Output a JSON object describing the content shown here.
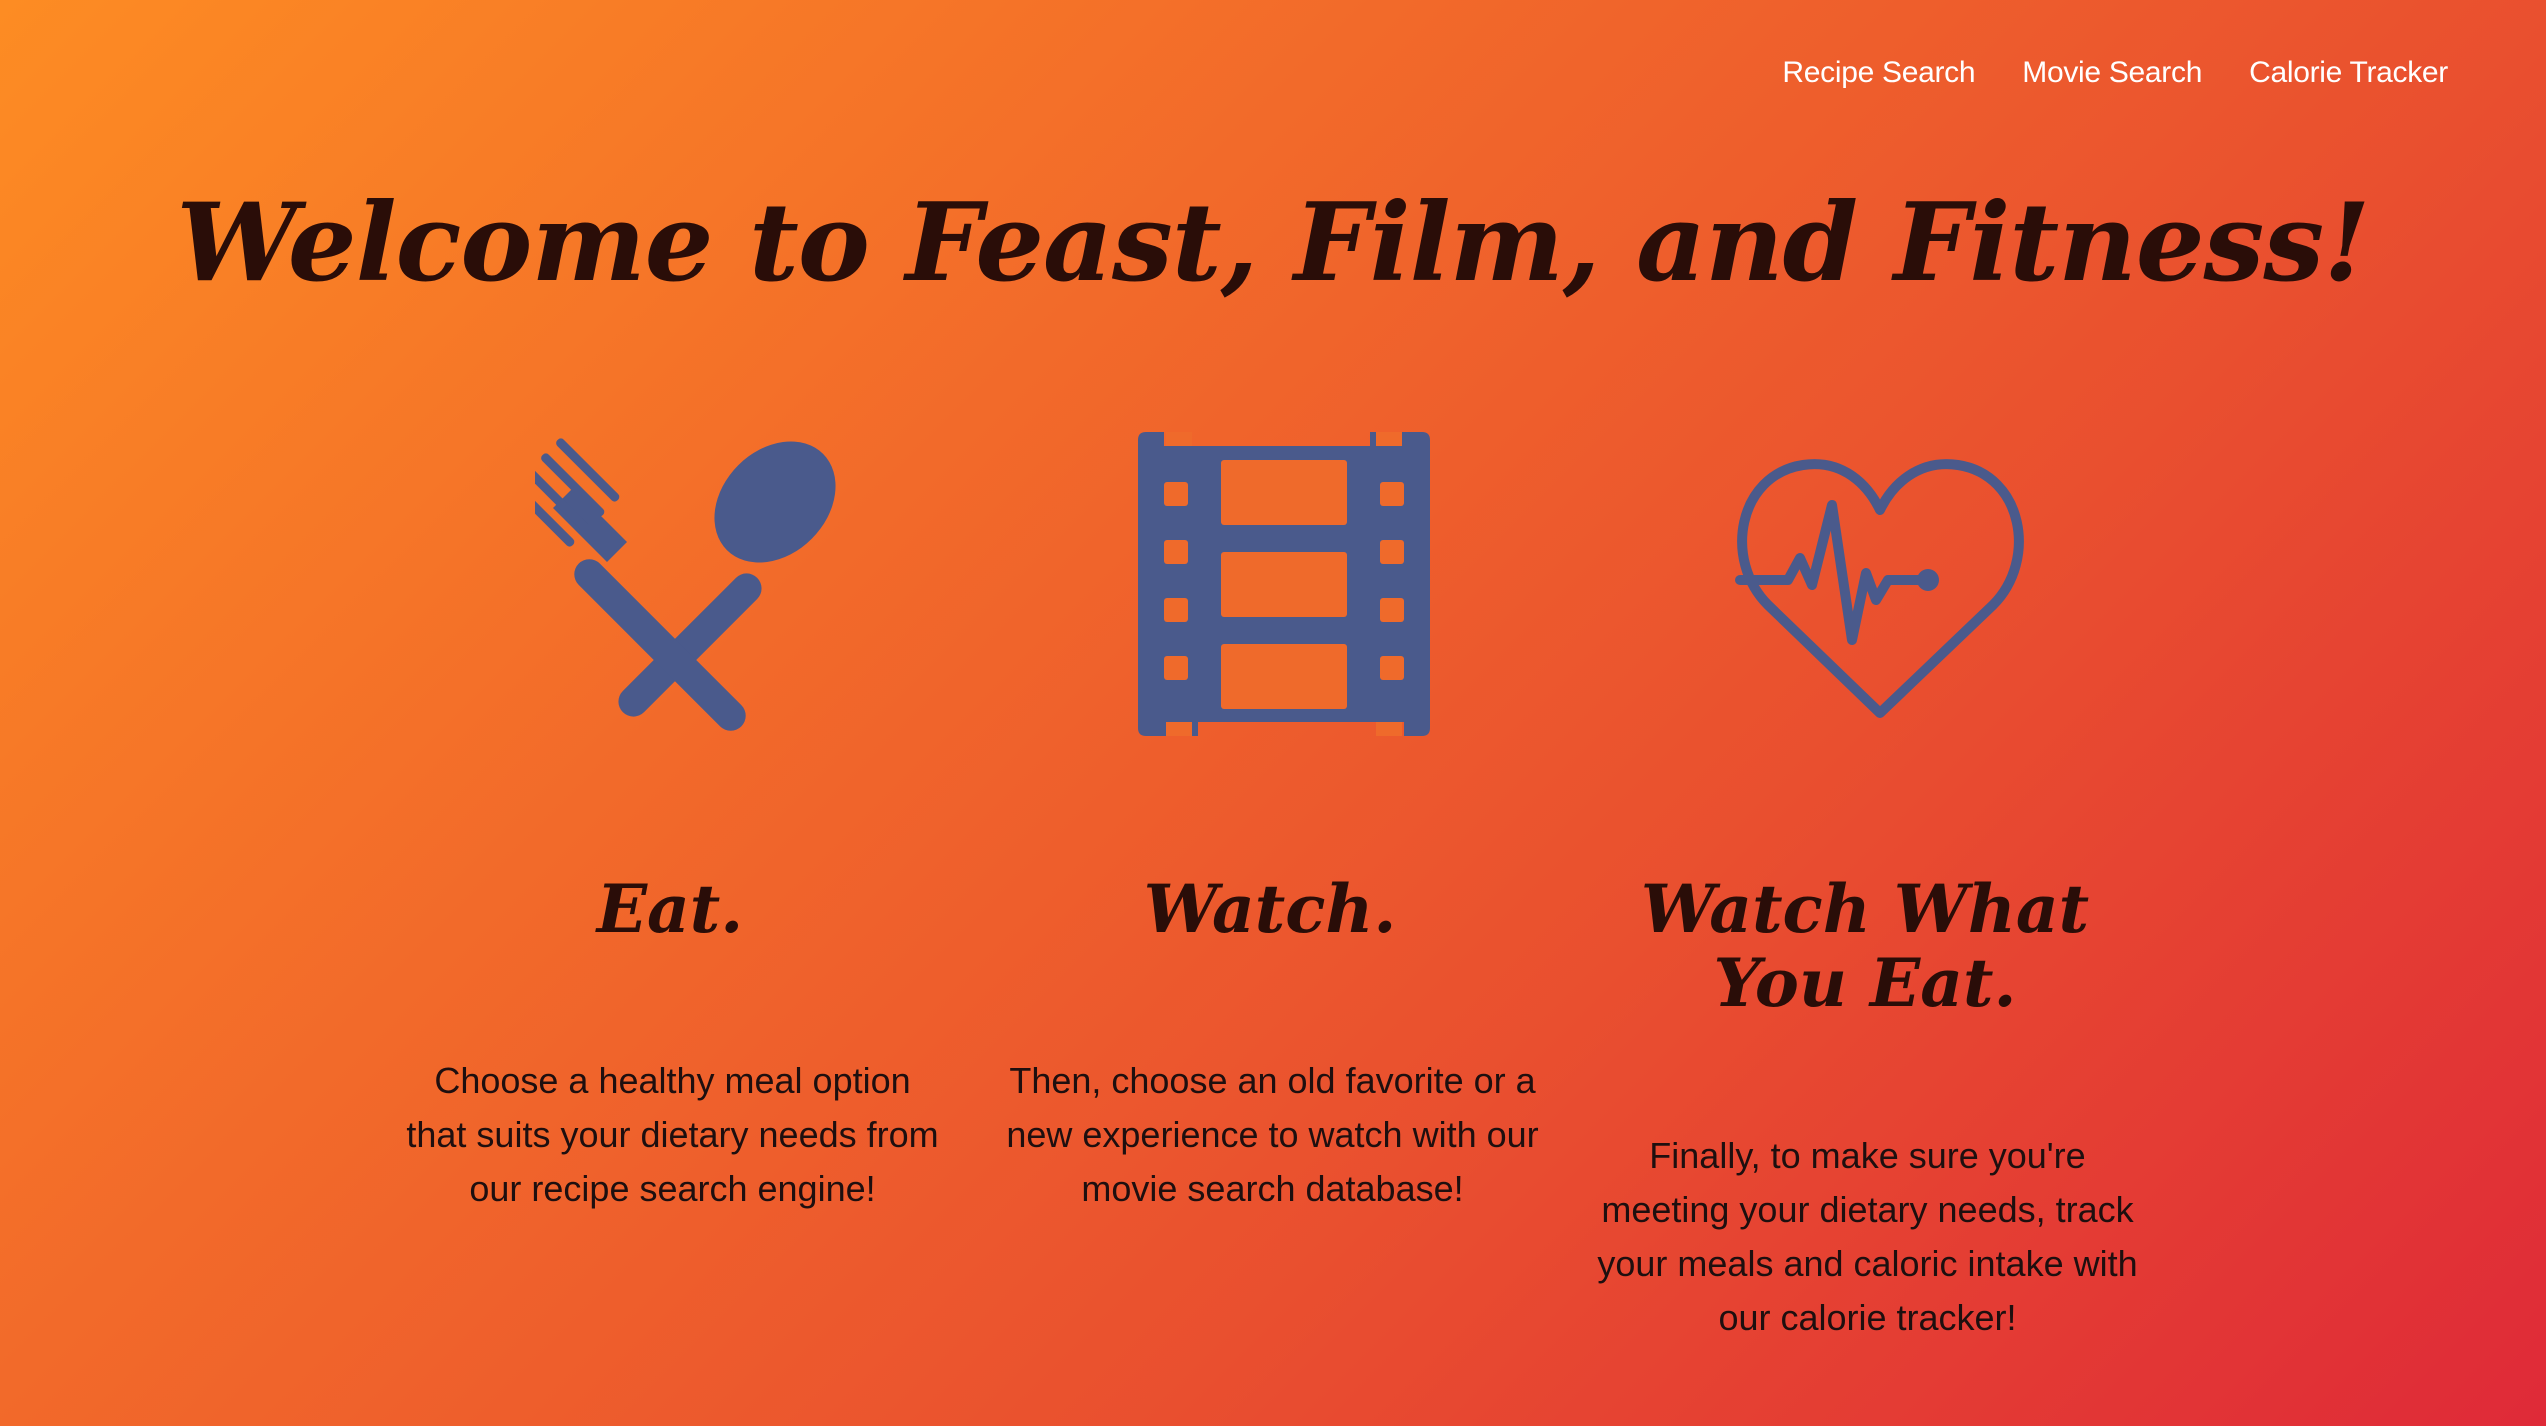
{
  "nav": {
    "items": [
      {
        "label": "Recipe Search"
      },
      {
        "label": "Movie Search"
      },
      {
        "label": "Calorie Tracker"
      }
    ]
  },
  "hero": {
    "title": "Welcome to Feast, Film, and Fitness!"
  },
  "features": [
    {
      "icon": "fork-spoon-icon",
      "heading": "Eat.",
      "text": "Choose a healthy meal option that suits your dietary needs from our recipe search engine!"
    },
    {
      "icon": "film-strip-icon",
      "heading": "Watch.",
      "text": "Then, choose an old favorite or a new experience to watch with our movie search database!"
    },
    {
      "icon": "heart-pulse-icon",
      "heading": "Watch What You Eat.",
      "text": "Finally, to make sure you're meeting your dietary needs, track your meals and caloric intake with our calorie tracker!"
    }
  ],
  "colors": {
    "gradient_start": "#fd8c23",
    "gradient_end": "#df2a38",
    "icon": "#4a5a8c",
    "heading": "#2a0d08",
    "nav_text": "#ffffff"
  }
}
